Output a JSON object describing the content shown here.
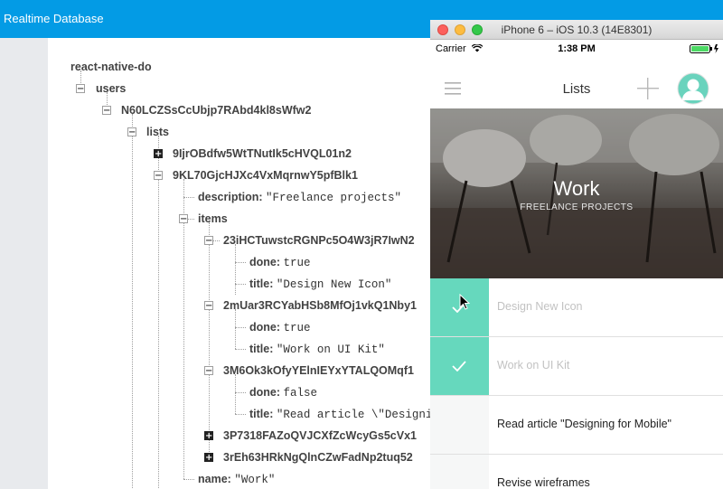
{
  "header": {
    "title": "Realtime Database"
  },
  "tree": {
    "root": "react-native-do",
    "users": "users",
    "user_id": "N60LCZSsCcUbjp7RAbd4kl8sWfw2",
    "lists": "lists",
    "list_collapsed": "9IjrOBdfw5WtTNutIk5cHVQL01n2",
    "list_expanded": "9KL70GjcHJXc4VxMqrnwY5pfBlk1",
    "description_key": "description:",
    "description_value": "\"Freelance projects\"",
    "items": "items",
    "item1_id": "23iHCTuwstcRGNPc5O4W3jR7IwN2",
    "item2_id": "2mUar3RCYabHSb8MfOj1vkQ1Nby1",
    "item3_id": "3M6Ok3kOfyYElnIEYxYTALQOMqf1",
    "item4_id": "3P7318FAZoQVJCXfZcWcyGs5cVx1",
    "item5_id": "3rEh63HRkNgQlnCZwFadNp2tuq52",
    "done_key": "done:",
    "title_key": "title:",
    "item1_done": "true",
    "item1_title": "\"Design New Icon\"",
    "item2_done": "true",
    "item2_title": "\"Work on UI Kit\"",
    "item3_done": "false",
    "item3_title": "\"Read article \\\"Designin",
    "name_key": "name:",
    "name_value": "\"Work\""
  },
  "simulator": {
    "window_title": "iPhone 6 – iOS 10.3 (14E8301)",
    "carrier": "Carrier",
    "time": "1:38 PM",
    "nav_title": "Lists",
    "hero_title": "Work",
    "hero_subtitle": "FREELANCE PROJECTS",
    "items": [
      {
        "label": "Design New Icon",
        "done": true
      },
      {
        "label": "Work on UI Kit",
        "done": true
      },
      {
        "label": "Read article \"Designing for Mobile\"",
        "done": false
      },
      {
        "label": "Revise wireframes",
        "done": false
      }
    ],
    "colors": {
      "accent": "#66d8bd",
      "firebase_blue": "#039be5"
    }
  }
}
